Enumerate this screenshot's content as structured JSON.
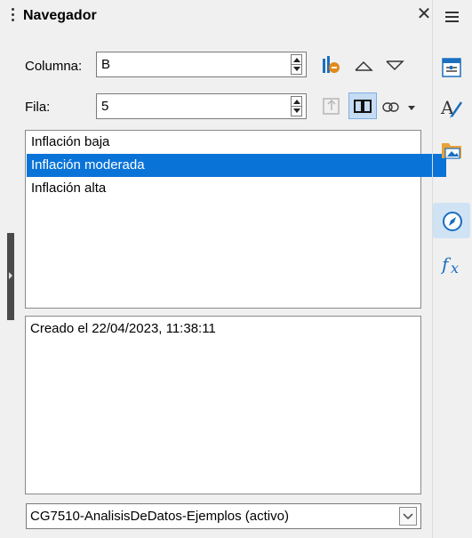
{
  "panel": {
    "title": "Navegador"
  },
  "controls": {
    "column_label": "Columna:",
    "column_value": "B",
    "row_label": "Fila:",
    "row_value": "5"
  },
  "scenarios": [
    {
      "label": "Inflación baja",
      "selected": false
    },
    {
      "label": "Inflación moderada",
      "selected": true
    },
    {
      "label": "Inflación alta",
      "selected": false
    }
  ],
  "comment": "Creado el 22/04/2023, 11:38:11",
  "document_select": {
    "value": "CG7510-AnalisisDeDatos-Ejemplos (activo)"
  },
  "colors": {
    "accent": "#0a73d8",
    "active_tab": "#cfe3f5",
    "icon_blue": "#1a6fbf",
    "icon_orange": "#e08a1e"
  },
  "icons": [
    "grip-icon",
    "close-icon",
    "menu-icon",
    "data-range-icon",
    "arrow-up-icon",
    "arrow-down-icon",
    "toggle-icon",
    "scenarios-icon",
    "drag-mode-icon",
    "properties-icon",
    "styles-icon",
    "gallery-icon",
    "navigator-icon",
    "functions-icon"
  ]
}
